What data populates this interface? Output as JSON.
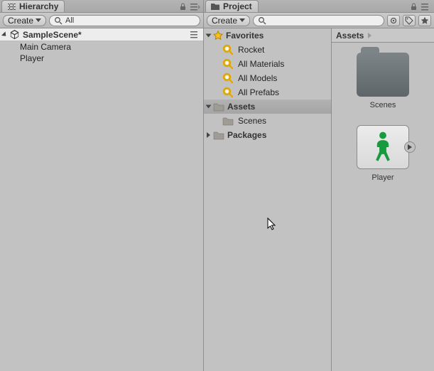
{
  "hierarchy": {
    "tabTitle": "Hierarchy",
    "createLabel": "Create",
    "searchValue": "All",
    "sceneName": "SampleScene*",
    "objects": [
      "Main Camera",
      "Player"
    ]
  },
  "project": {
    "tabTitle": "Project",
    "createLabel": "Create",
    "searchPlaceholder": "",
    "tree": {
      "favoritesLabel": "Favorites",
      "favorites": [
        "Rocket",
        "All Materials",
        "All Models",
        "All Prefabs"
      ],
      "assetsLabel": "Assets",
      "assetsChildren": [
        "Scenes"
      ],
      "packagesLabel": "Packages"
    },
    "breadcrumb": "Assets",
    "grid": {
      "folderName": "Scenes",
      "prefabName": "Player"
    }
  }
}
